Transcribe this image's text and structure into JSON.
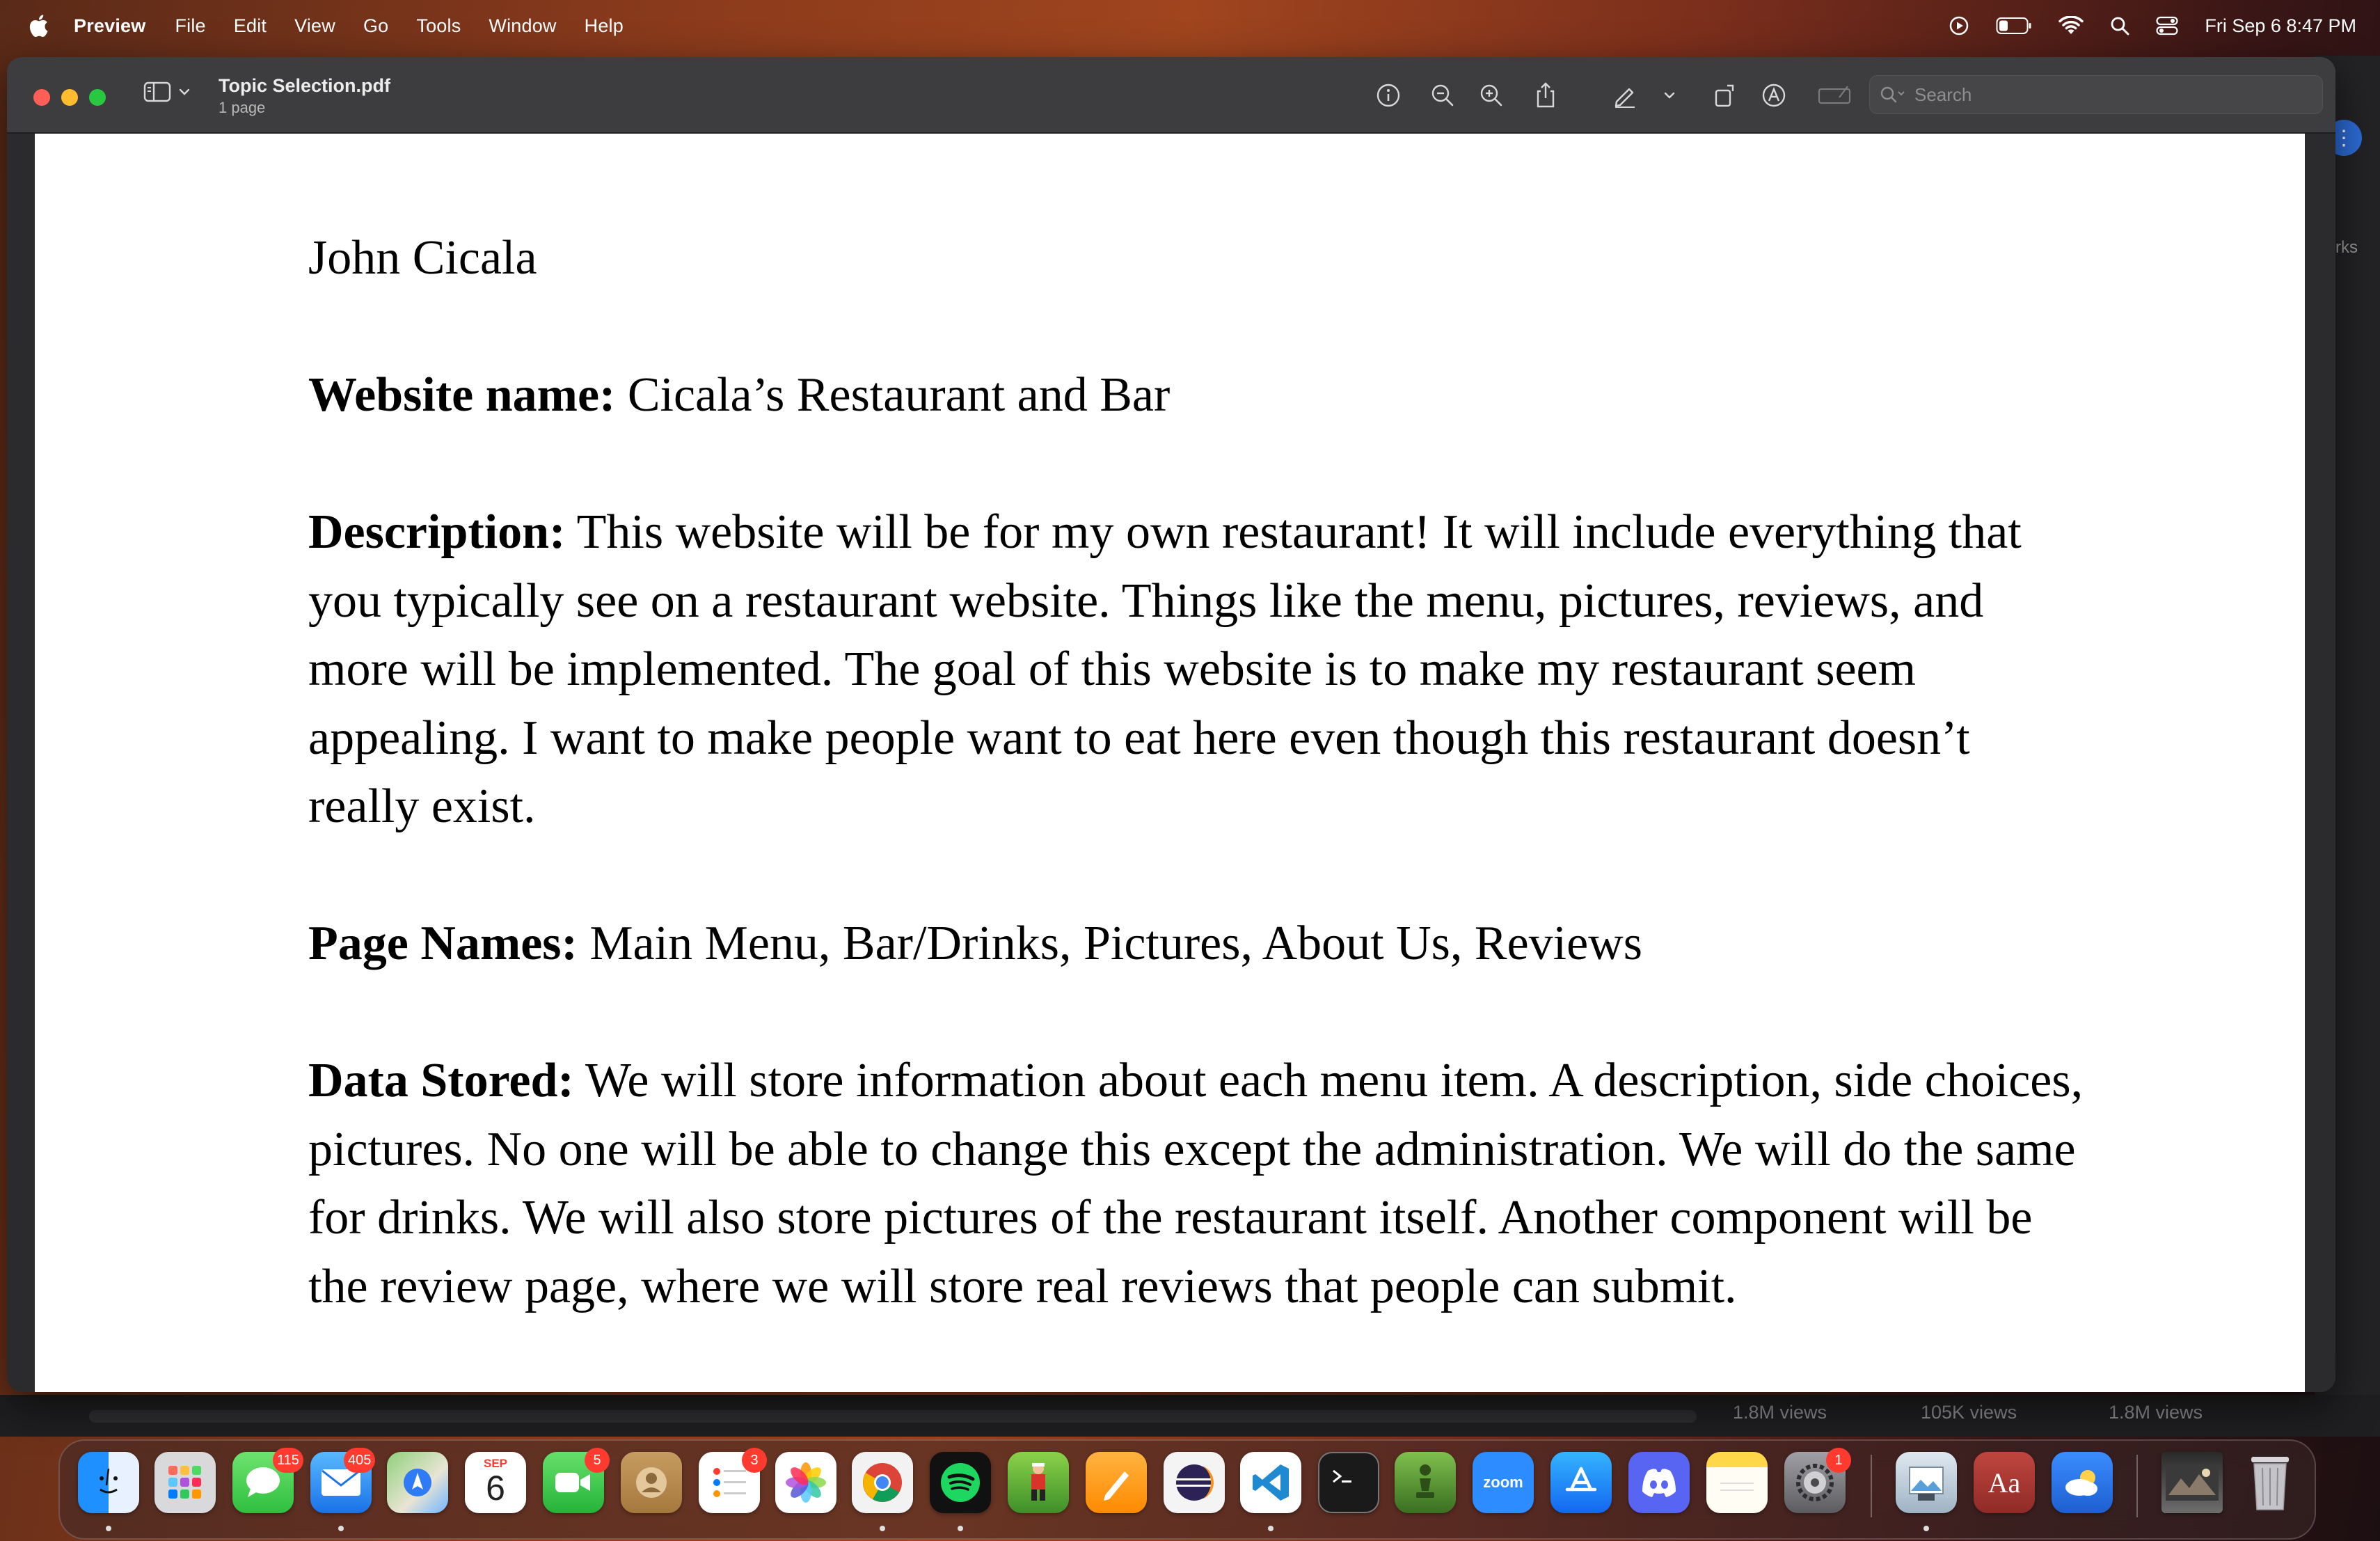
{
  "menubar": {
    "app_name": "Preview",
    "items": [
      "File",
      "Edit",
      "View",
      "Go",
      "Tools",
      "Window",
      "Help"
    ],
    "clock": "Fri Sep 6  8:47 PM"
  },
  "window": {
    "doc_title": "Topic Selection.pdf",
    "doc_subtitle": "1 page",
    "search_placeholder": "Search"
  },
  "document": {
    "name": "John Cicala",
    "website_label": "Website name:",
    "website_value": " Cicala’s Restaurant and Bar",
    "description_label": "Description:",
    "description_value": " This website will be for my own restaurant! It will include everything that you typically see on a restaurant website. Things like the menu, pictures, reviews, and more will be implemented. The goal of this website is to make my restaurant seem appealing. I want to make people want to eat here even though this restaurant doesn’t really exist.",
    "pages_label": "Page Names:",
    "pages_value": " Main Menu, Bar/Drinks, Pictures, About Us, Reviews",
    "data_label": "Data Stored:",
    "data_value": " We will store information about each menu item. A description, side choices, pictures. No one will be able to change this except the administration. We will do the same for drinks. We will also store pictures of the restaurant itself. Another component will be the review page, where we will store real reviews that people can submit."
  },
  "background": {
    "side_label": "rks",
    "views": [
      "1.8M views",
      "105K views",
      "1.8M views"
    ]
  },
  "dock": {
    "badges": {
      "messages": "115",
      "mail": "405",
      "calendar_month": "SEP",
      "calendar_day": "6",
      "facetime": "5",
      "reminders": "3",
      "settings": "1"
    },
    "zoom_label": "zoom",
    "dictionary_label": "Aa",
    "apps": [
      "finder",
      "launchpad",
      "messages",
      "mail",
      "maps",
      "calendar",
      "facetime",
      "contacts",
      "reminders",
      "photos",
      "chrome",
      "spotify",
      "game",
      "pages",
      "eclipse",
      "vscode",
      "terminal",
      "chess",
      "zoom",
      "app-store",
      "discord",
      "notes",
      "system-settings",
      "preview",
      "dictionary",
      "weather",
      "photo-thumb",
      "trash"
    ]
  }
}
